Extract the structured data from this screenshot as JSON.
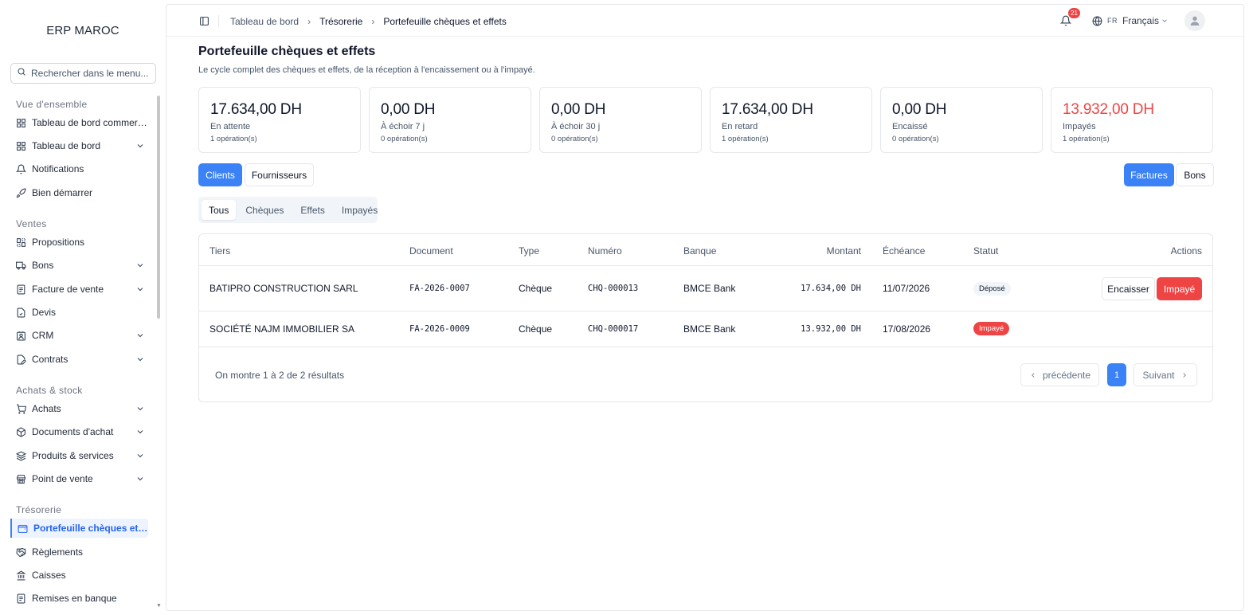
{
  "brand": "ERP MAROC",
  "sidebar": {
    "search_placeholder": "Rechercher dans le menu...",
    "sections": {
      "overview": "Vue d'ensemble",
      "ventes": "Ventes",
      "achats": "Achats & stock",
      "tresorerie": "Trésorerie"
    },
    "items": [
      {
        "label": "Tableau de bord commercial",
        "icon": "grid-icon"
      },
      {
        "label": "Tableau de bord",
        "icon": "grid-icon"
      },
      {
        "label": "Notifications",
        "icon": "bell-icon"
      },
      {
        "label": "Bien démarrer",
        "icon": "rocket-icon"
      },
      {
        "label": "Propositions",
        "icon": "layout-icon"
      },
      {
        "label": "Bons",
        "icon": "truck-icon"
      },
      {
        "label": "Facture de vente",
        "icon": "receipt-icon"
      },
      {
        "label": "Devis",
        "icon": "file-check-icon"
      },
      {
        "label": "CRM",
        "icon": "contact-icon"
      },
      {
        "label": "Contrats",
        "icon": "file-pen-icon"
      },
      {
        "label": "Achats",
        "icon": "cart-icon"
      },
      {
        "label": "Documents d'achat",
        "icon": "package-icon"
      },
      {
        "label": "Produits & services",
        "icon": "layers-icon"
      },
      {
        "label": "Point de vente",
        "icon": "store-icon"
      },
      {
        "label": "Portefeuille chèques et effets",
        "icon": "wallet-icon"
      },
      {
        "label": "Règlements",
        "icon": "handshake-icon"
      },
      {
        "label": "Caisses",
        "icon": "bank-icon"
      },
      {
        "label": "Remises en banque",
        "icon": "receipt-icon"
      }
    ]
  },
  "topbar": {
    "breadcrumb": [
      "Tableau de bord",
      "Trésorerie",
      "Portefeuille chèques et effets"
    ],
    "notif_count": "21",
    "lang_code": "FR",
    "lang_label": "Français"
  },
  "page": {
    "title": "Portefeuille chèques et effets",
    "subtitle": "Le cycle complet des chèques et effets, de la réception à l'encaissement ou à l'impayé."
  },
  "cards": [
    {
      "amount": "17.634,00 DH",
      "label": "En attente",
      "ops": "1 opération(s)"
    },
    {
      "amount": "0,00 DH",
      "label": "À échoir 7 j",
      "ops": "0 opération(s)"
    },
    {
      "amount": "0,00 DH",
      "label": "À échoir 30 j",
      "ops": "0 opération(s)"
    },
    {
      "amount": "17.634,00 DH",
      "label": "En retard",
      "ops": "1 opération(s)"
    },
    {
      "amount": "0,00 DH",
      "label": "Encaissé",
      "ops": "0 opération(s)"
    },
    {
      "amount": "13.932,00 DH",
      "label": "Impayés",
      "ops": "1 opération(s)"
    }
  ],
  "toggles": {
    "clients": "Clients",
    "fournisseurs": "Fournisseurs",
    "factures": "Factures",
    "bons": "Bons"
  },
  "tabs": [
    "Tous",
    "Chèques",
    "Effets",
    "Impayés"
  ],
  "table": {
    "headers": [
      "Tiers",
      "Document",
      "Type",
      "Numéro",
      "Banque",
      "Montant",
      "Échéance",
      "Statut",
      "Actions"
    ],
    "rows": [
      {
        "tiers": "BATIPRO CONSTRUCTION SARL",
        "document": "FA-2026-0007",
        "type": "Chèque",
        "numero": "CHQ-000013",
        "banque": "BMCE Bank",
        "montant": "17.634,00 DH",
        "echeance": "11/07/2026",
        "statut": "Déposé"
      },
      {
        "tiers": "SOCIÉTÉ NAJM IMMOBILIER SA",
        "document": "FA-2026-0009",
        "type": "Chèque",
        "numero": "CHQ-000017",
        "banque": "BMCE Bank",
        "montant": "13.932,00 DH",
        "echeance": "17/08/2026",
        "statut": "Impayé"
      }
    ],
    "actions": {
      "encaisser": "Encaisser",
      "impaye": "Impayé"
    },
    "footer": "On montre 1 à 2 de 2 résultats",
    "pager": {
      "prev": "précédente",
      "page": "1",
      "next": "Suivant"
    }
  },
  "colors": {
    "accent": "#3b82f6",
    "danger": "#ef4444"
  }
}
